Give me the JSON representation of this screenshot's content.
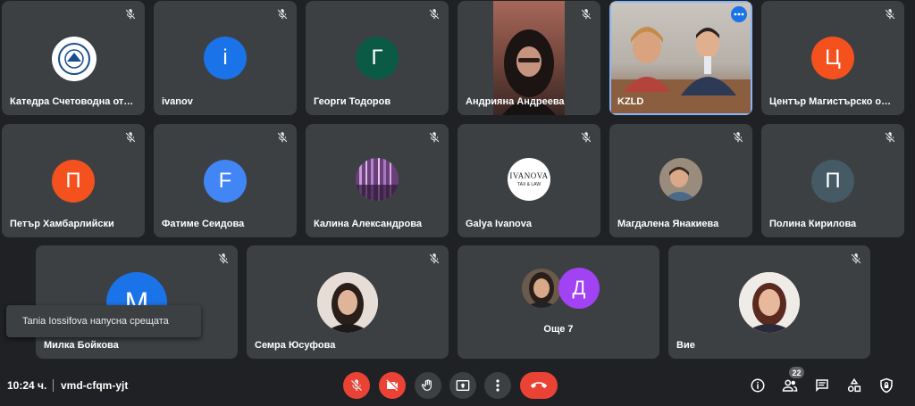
{
  "participants": [
    {
      "name": "Катедра Счетоводна отч..."
    },
    {
      "name": "ivanov",
      "initial": "i"
    },
    {
      "name": "Георги Тодоров",
      "initial": "Г"
    },
    {
      "name": "Андрияна Андреева"
    },
    {
      "name": "KZLD"
    },
    {
      "name": "Център Магистърско обу...",
      "initial": "Ц"
    },
    {
      "name": "Петър Хамбарлийски",
      "initial": "П"
    },
    {
      "name": "Фатиме Сеидова",
      "initial": "F"
    },
    {
      "name": "Калина Александрова"
    },
    {
      "name": "Galya Ivanova",
      "logo_line1": "IVANOVA",
      "logo_line2": "TAX & LAW"
    },
    {
      "name": "Магдалена Янакиева"
    },
    {
      "name": "Полина Кирилова",
      "initial": "П"
    },
    {
      "name": "Милка Бойкова",
      "initial": "M"
    },
    {
      "name": "Семра Юсуфова"
    },
    {
      "name": "Още 7",
      "initial": "Д"
    },
    {
      "name": "Вие"
    }
  ],
  "toast": {
    "text": "Tania Iossifova напусна срещата"
  },
  "bottombar": {
    "time": "10:24 ч.",
    "meeting_code": "vmd-cfqm-yjt",
    "participants_count": "22"
  },
  "colors": {
    "background": "#202124",
    "tile": "#3c4043",
    "red": "#ea4335",
    "accent": "#1a73e8"
  }
}
